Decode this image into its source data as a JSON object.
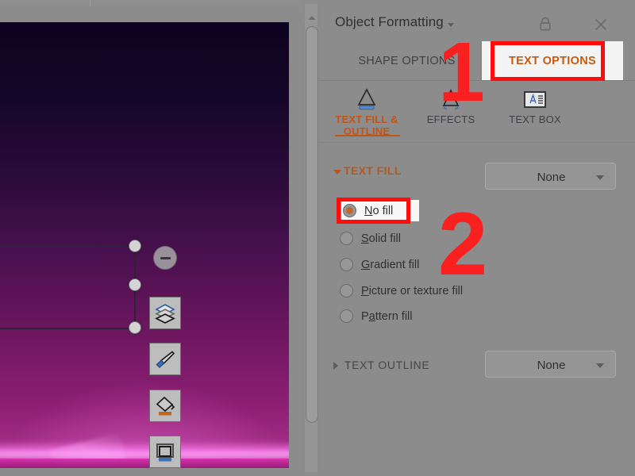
{
  "window": {
    "app_background": "#8c8c8c"
  },
  "slide": {
    "name": "slide-canvas",
    "gradient_top": "#0d0420",
    "gradient_bottom": "#b03a90",
    "glow_color": "#ff78f0"
  },
  "slide_toolbar": {
    "name": "floating-format-toolbar",
    "buttons": [
      {
        "icon": "minus-icon",
        "label": "Collapse"
      },
      {
        "icon": "layers-icon",
        "label": "Layout"
      },
      {
        "icon": "paintbrush-icon",
        "label": "Theme"
      },
      {
        "icon": "paint-bucket-icon",
        "label": "Fill Color"
      },
      {
        "icon": "shape-frame-icon",
        "label": "Shape Style"
      }
    ]
  },
  "scrollbar": {
    "name": "vertical-scrollbar",
    "up_arrow_icon": "chevron-up-icon"
  },
  "pane": {
    "title": "Object Formatting",
    "title_caret_icon": "chevron-down-icon",
    "lock_icon": "lock-icon",
    "close_icon": "close-icon",
    "tabs": [
      {
        "label": "SHAPE OPTIONS",
        "active": false
      },
      {
        "label": "TEXT OPTIONS",
        "active": true
      }
    ],
    "accent_active": "#c55a11",
    "subtabs": [
      {
        "label": "TEXT FILL & OUTLINE",
        "icon": "text-fill-outline-icon",
        "active": true
      },
      {
        "label": "EFFECTS",
        "icon": "text-effects-icon",
        "active": false
      },
      {
        "label": "TEXT BOX",
        "icon": "text-box-icon",
        "active": false
      }
    ],
    "text_fill": {
      "section_label": "TEXT FILL",
      "expanded": true,
      "caret_icon": "caret-down-icon",
      "dropdown_value": "None",
      "dropdown_caret_icon": "caret-down-icon",
      "options": [
        {
          "label_pre": "",
          "label_key": "N",
          "label_post": "o fill",
          "selected": true
        },
        {
          "label_pre": "",
          "label_key": "S",
          "label_post": "olid fill",
          "selected": false
        },
        {
          "label_pre": "",
          "label_key": "G",
          "label_post": "radient fill",
          "selected": false
        },
        {
          "label_pre": "",
          "label_key": "P",
          "label_post": "icture or texture fill",
          "selected": false
        },
        {
          "label_pre": "P",
          "label_key": "a",
          "label_post": "ttern fill",
          "selected": false
        }
      ],
      "selected_dot_color": "#c0672b"
    },
    "text_outline": {
      "section_label": "TEXT OUTLINE",
      "expanded": false,
      "caret_icon": "caret-right-icon",
      "dropdown_value": "None",
      "dropdown_caret_icon": "caret-down-icon"
    }
  },
  "annotations": {
    "color": "#ff0d0d",
    "markers": [
      {
        "number": "1",
        "target": "TEXT OPTIONS tab"
      },
      {
        "number": "2",
        "target": "No fill radio"
      }
    ]
  }
}
